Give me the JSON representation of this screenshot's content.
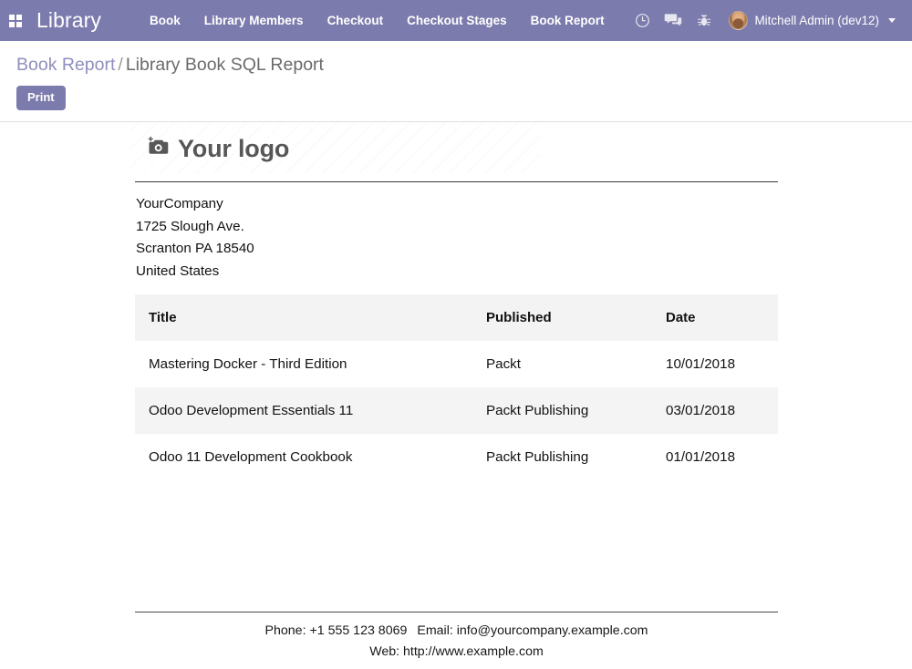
{
  "navbar": {
    "apps_icon": "apps-grid-icon",
    "brand": "Library",
    "menu": [
      {
        "label": "Book"
      },
      {
        "label": "Library Members"
      },
      {
        "label": "Checkout"
      },
      {
        "label": "Checkout Stages"
      },
      {
        "label": "Book Report"
      }
    ],
    "sys_icons": [
      {
        "name": "clock-icon"
      },
      {
        "name": "chat-icon"
      },
      {
        "name": "bug-icon"
      }
    ],
    "user": {
      "avatar": "user-avatar",
      "name": "Mitchell Admin (dev12)",
      "caret": "chevron-down-icon"
    },
    "background_color": "#7C7BAD"
  },
  "control_panel": {
    "breadcrumb": {
      "parent": "Book Report",
      "separator": "/",
      "current": "Library Book SQL Report"
    },
    "print_label": "Print",
    "accent_color": "#7C7BAD"
  },
  "report": {
    "logo": {
      "icon": "camera-add-icon",
      "text": "Your logo"
    },
    "company": {
      "name": "YourCompany",
      "street": "1725 Slough Ave.",
      "city_state_zip": "Scranton PA 18540",
      "country": "United States"
    },
    "table": {
      "columns": [
        "Title",
        "Published",
        "Date"
      ],
      "rows": [
        {
          "title": "Mastering Docker - Third Edition",
          "published": "Packt",
          "date": "10/01/2018"
        },
        {
          "title": "Odoo Development Essentials 11",
          "published": "Packt Publishing",
          "date": "03/01/2018"
        },
        {
          "title": "Odoo 11 Development Cookbook",
          "published": "Packt Publishing",
          "date": "01/01/2018"
        }
      ]
    },
    "footer": {
      "phone": "Phone: +1 555 123 8069",
      "email": "Email: info@yourcompany.example.com",
      "web": "Web: http://www.example.com"
    }
  }
}
